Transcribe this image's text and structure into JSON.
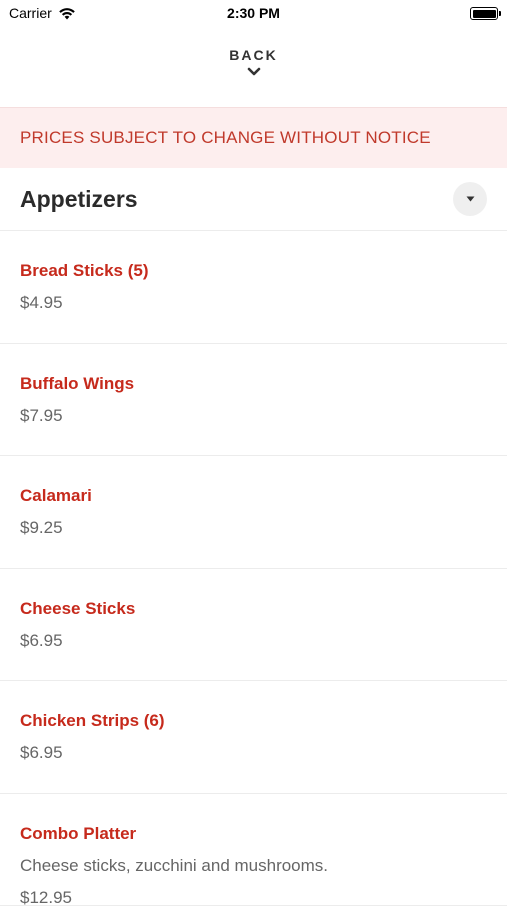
{
  "status_bar": {
    "carrier": "Carrier",
    "time": "2:30 PM"
  },
  "nav": {
    "back_label": "BACK",
    "back_icon": "chevron-down-icon"
  },
  "notice": {
    "text": "PRICES SUBJECT TO CHANGE WITHOUT NOTICE",
    "color": "#c0392b",
    "background": "#fdeeee"
  },
  "category": {
    "title": "Appetizers",
    "toggle_icon": "caret-down-icon"
  },
  "items": [
    {
      "name": "Bread Sticks (5)",
      "description": "",
      "price": "$4.95"
    },
    {
      "name": "Buffalo Wings",
      "description": "",
      "price": "$7.95"
    },
    {
      "name": "Calamari",
      "description": "",
      "price": "$9.25"
    },
    {
      "name": "Cheese Sticks",
      "description": "",
      "price": "$6.95"
    },
    {
      "name": "Chicken Strips (6)",
      "description": "",
      "price": "$6.95"
    },
    {
      "name": "Combo Platter",
      "description": "Cheese sticks, zucchini and mushrooms.",
      "price": "$12.95"
    }
  ],
  "colors": {
    "accent": "#c62a1c",
    "text_secondary": "#666666"
  }
}
